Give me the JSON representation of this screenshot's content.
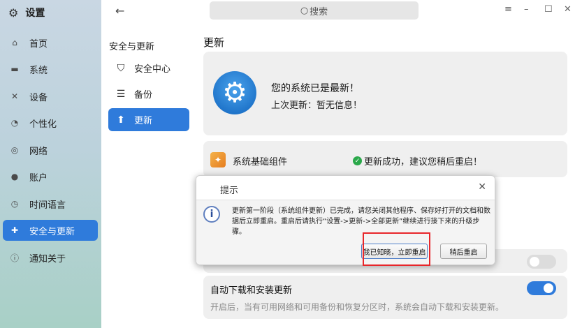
{
  "sidebar": {
    "app_title": "设置",
    "items": [
      {
        "label": "首页",
        "icon": "home-icon"
      },
      {
        "label": "系统",
        "icon": "monitor-icon"
      },
      {
        "label": "设备",
        "icon": "devices-icon"
      },
      {
        "label": "个性化",
        "icon": "palette-icon"
      },
      {
        "label": "网络",
        "icon": "network-icon"
      },
      {
        "label": "账户",
        "icon": "user-icon"
      },
      {
        "label": "时间语言",
        "icon": "clock-icon"
      },
      {
        "label": "安全与更新",
        "icon": "shield-icon",
        "active": true
      },
      {
        "label": "通知关于",
        "icon": "info-icon"
      }
    ]
  },
  "header": {
    "search_placeholder": "搜索"
  },
  "subnav": {
    "heading": "安全与更新",
    "items": [
      {
        "label": "安全中心",
        "icon": "shield-outline-icon"
      },
      {
        "label": "备份",
        "icon": "backup-icon"
      },
      {
        "label": "更新",
        "icon": "arrow-up-icon",
        "active": true
      }
    ]
  },
  "content": {
    "title": "更新",
    "status_title": "您的系统已是最新！",
    "status_sub": "上次更新：暂无信息！",
    "component_name": "系统基础组件",
    "component_status": "更新成功，建议您稍后重启！",
    "auto_update_label": "自动下载和安装更新",
    "auto_update_desc": "开启后，当有可用网络和可用备份和恢复分区时，系统会自动下载和安装更新。"
  },
  "dialog": {
    "title": "提示",
    "message": "更新第一阶段（系统组件更新）已完成，请您关闭其他程序、保存好打开的文档和数据后立即重启。重启后请执行“设置->更新->全部更新”继续进行接下来的升级步骤。",
    "confirm_label": "我已知晓，立即重启",
    "later_label": "稍后重启"
  },
  "colors": {
    "accent": "#2f7bdb",
    "success": "#2aa84a",
    "highlight": "#e8262a"
  }
}
